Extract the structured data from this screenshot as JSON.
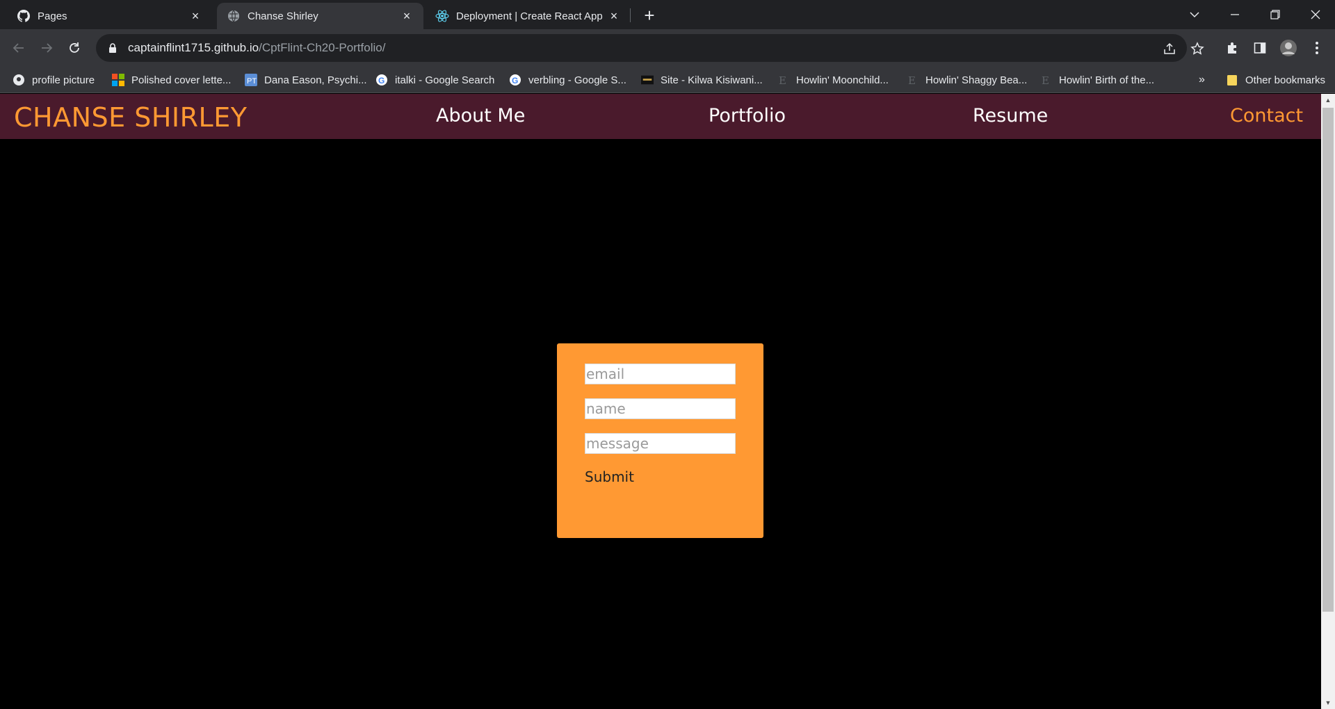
{
  "browser": {
    "tabs": [
      {
        "title": "Pages",
        "icon": "github-icon"
      },
      {
        "title": "Chanse Shirley",
        "icon": "globe-icon",
        "active": true
      },
      {
        "title": "Deployment | Create React App",
        "icon": "react-icon"
      }
    ],
    "url_host": "captainflint1715.github.io",
    "url_path": "/CptFlint-Ch20-Portfolio/",
    "bookmarks": [
      "profile picture",
      "Polished cover lette...",
      "Dana Eason, Psychi...",
      "italki - Google Search",
      "verbling - Google S...",
      "Site - Kilwa Kisiwani...",
      "Howlin' Moonchild...",
      "Howlin' Shaggy Bea...",
      "Howlin' Birth of the..."
    ],
    "bookmarks_overflow": "»",
    "other_bookmarks": "Other bookmarks"
  },
  "site": {
    "brand": "CHANSE SHIRLEY",
    "nav": [
      "About Me",
      "Portfolio",
      "Resume",
      "Contact"
    ],
    "active_nav": "Contact"
  },
  "contact_form": {
    "email_placeholder": "email",
    "name_placeholder": "name",
    "message_placeholder": "message",
    "submit_label": "Submit"
  },
  "colors": {
    "accent": "#ff9933",
    "nav_bg": "#4a1a2c",
    "page_bg": "#000000"
  }
}
